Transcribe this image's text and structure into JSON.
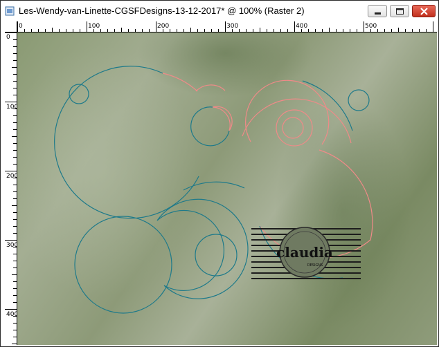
{
  "window": {
    "title": "Les-Wendy-van-Linette-CGSFDesigns-13-12-2017* @ 100% (Raster 2)"
  },
  "ruler": {
    "horizontal_labels": [
      "0",
      "100",
      "200",
      "300",
      "400",
      "500"
    ],
    "vertical_labels": [
      "0",
      "100",
      "200",
      "300",
      "400"
    ]
  },
  "watermark": {
    "text": "claudia",
    "subtext": "DESIGNS"
  },
  "colors": {
    "teal": "#1e7a8a",
    "salmon": "#f08a88"
  }
}
